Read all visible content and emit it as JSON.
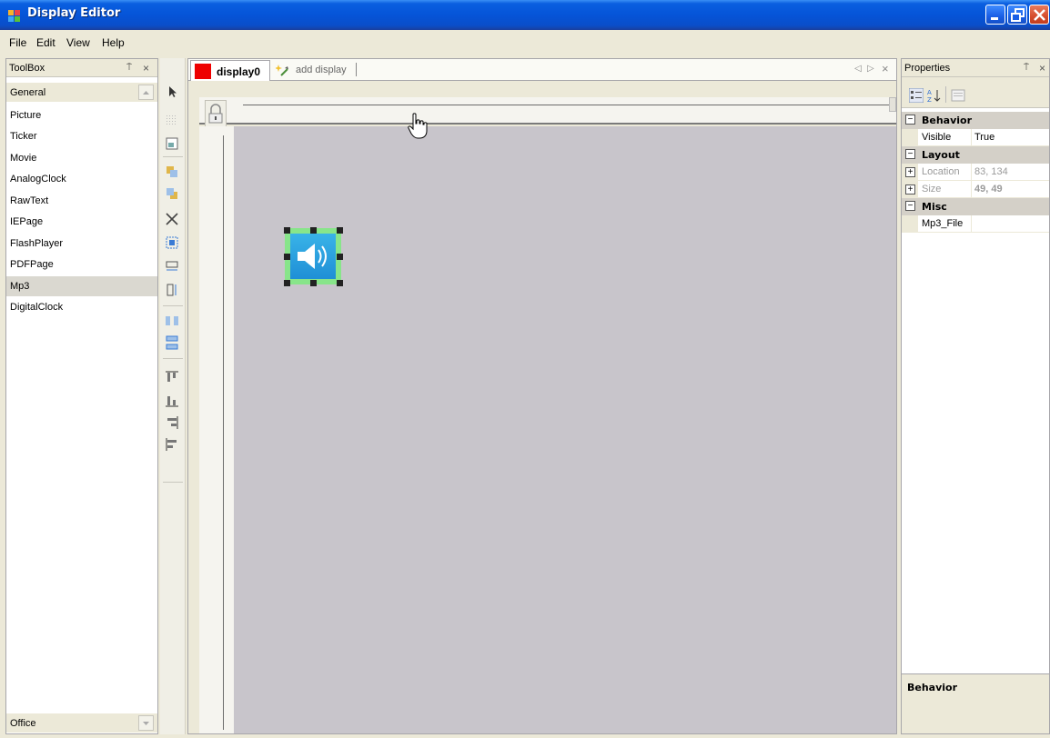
{
  "window": {
    "title": "Display Editor",
    "colors": {
      "titlebar": "#0554d8",
      "close": "#d54d2d"
    }
  },
  "menu": [
    "File",
    "Edit",
    "View",
    "Help"
  ],
  "toolbox": {
    "title": "ToolBox",
    "pin": "⍑",
    "close": "×",
    "group_top": "General",
    "group_bottom": "Office",
    "items": [
      "Picture",
      "Ticker",
      "Movie",
      "AnalogClock",
      "RawText",
      "IEPage",
      "FlashPlayer",
      "PDFPage",
      "Mp3",
      "DigitalClock"
    ],
    "selected": "Mp3"
  },
  "layout_tools": [
    "pointer-icon",
    "grid-icon",
    "picture-icon",
    "bring-front-icon",
    "send-back-icon",
    "delete-icon",
    "center-icon",
    "same-width-icon",
    "same-height-icon",
    "horizontal-spacing-icon",
    "vertical-spacing-icon",
    "align-top-icon",
    "align-bottom-icon",
    "align-right-icon",
    "align-left-icon"
  ],
  "document": {
    "active_tab": "display0",
    "add_tab": "add display",
    "tab_color": "#ee0000",
    "nav_prev": "◁",
    "nav_next": "▷",
    "close": "×",
    "canvas_color": "#c8c5cb"
  },
  "properties": {
    "title": "Properties",
    "pin": "⍑",
    "close": "×",
    "categories": {
      "behavior": "Behavior",
      "layout": "Layout",
      "misc": "Misc"
    },
    "rows": {
      "visible": {
        "name": "Visible",
        "value": "True"
      },
      "location": {
        "name": "Location",
        "value": "83, 134"
      },
      "size": {
        "name": "Size",
        "value": "49, 49"
      },
      "mp3_file": {
        "name": "Mp3_File",
        "value": ""
      }
    },
    "description_title": "Behavior",
    "collapse_glyph": "−",
    "expand_glyph": "+"
  }
}
